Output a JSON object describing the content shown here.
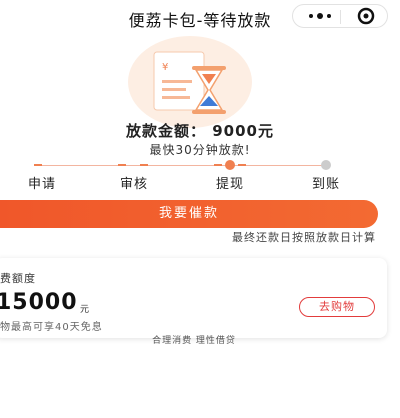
{
  "header": {
    "title": "便荔卡包-等待放款",
    "icons": [
      "more-icon",
      "target-icon"
    ]
  },
  "status": {
    "amount_text": "放款金额： 9000元",
    "subtitle": "最快30分钟放款!"
  },
  "progress": {
    "steps": [
      {
        "label": "申请",
        "state": "done"
      },
      {
        "label": "审核",
        "state": "done"
      },
      {
        "label": "提现",
        "state": "current"
      },
      {
        "label": "到账",
        "state": "pending"
      }
    ]
  },
  "actions": {
    "urge_label": "我要催款",
    "note": "最终还款日按照放款日计算"
  },
  "card": {
    "label": "费额度",
    "amount": "15000",
    "unit": "元",
    "desc": "物最高可享40天免息",
    "shop_label": "去购物"
  },
  "footer": {
    "note": "合理消费 理性借贷"
  },
  "colors": {
    "accent": "#f0572a",
    "progress_done": "#f08050",
    "progress_pending": "#cccccc",
    "shop_border": "#e23c3c"
  }
}
